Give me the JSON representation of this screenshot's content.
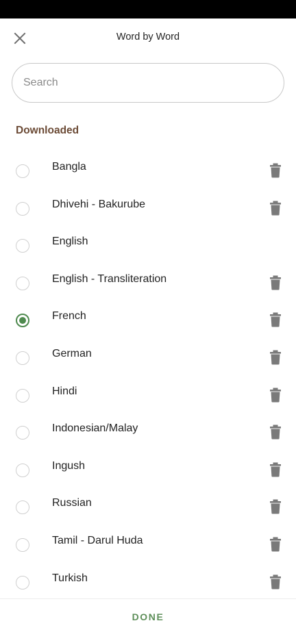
{
  "header": {
    "title": "Word by Word",
    "close_icon": "close-icon"
  },
  "search": {
    "placeholder": "Search",
    "value": ""
  },
  "section": {
    "title": "Downloaded"
  },
  "languages": [
    {
      "label": "Bangla",
      "selected": false,
      "deletable": true
    },
    {
      "label": "Dhivehi - Bakurube",
      "selected": false,
      "deletable": true
    },
    {
      "label": "English",
      "selected": false,
      "deletable": false
    },
    {
      "label": "English - Transliteration",
      "selected": false,
      "deletable": true
    },
    {
      "label": "French",
      "selected": true,
      "deletable": true
    },
    {
      "label": "German",
      "selected": false,
      "deletable": true
    },
    {
      "label": "Hindi",
      "selected": false,
      "deletable": true
    },
    {
      "label": "Indonesian/Malay",
      "selected": false,
      "deletable": true
    },
    {
      "label": "Ingush",
      "selected": false,
      "deletable": true
    },
    {
      "label": "Russian",
      "selected": false,
      "deletable": true
    },
    {
      "label": "Tamil - Darul Huda",
      "selected": false,
      "deletable": true
    },
    {
      "label": "Turkish",
      "selected": false,
      "deletable": true
    }
  ],
  "footer": {
    "done_label": "DONE"
  },
  "colors": {
    "accent": "#4f8a4f",
    "section_title": "#6b4a35",
    "trash_icon": "#7a7a7a"
  }
}
